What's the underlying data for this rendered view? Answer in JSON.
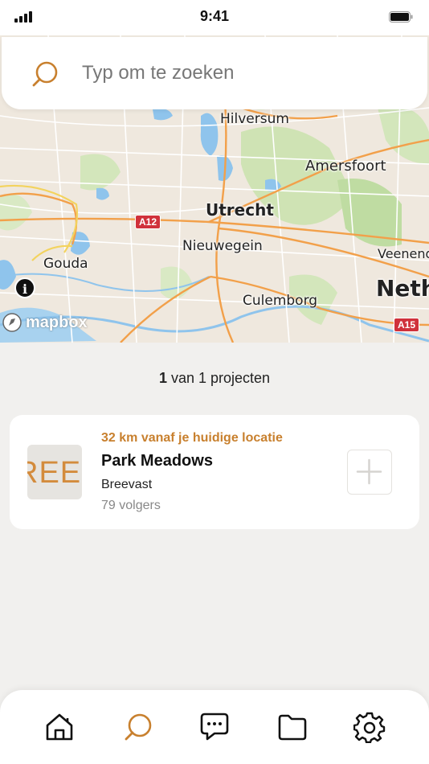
{
  "status_bar": {
    "time": "9:41"
  },
  "search": {
    "placeholder": "Typ om te zoeken"
  },
  "map": {
    "labels": {
      "hilversum": "Hilversum",
      "amersfoort": "Amersfoort",
      "utrecht": "Utrecht",
      "nieuwegein": "Nieuwegein",
      "gouda": "Gouda",
      "veenendaal": "Veenend",
      "culemborg": "Culemborg",
      "netherlands": "Neth"
    },
    "road_shields": {
      "a12": "A12",
      "a15": "A15"
    },
    "attribution": "mapbox",
    "info_glyph": "i"
  },
  "results": {
    "current": "1",
    "suffix": " van 1 projecten"
  },
  "project": {
    "distance": "32 km vanaf je huidige locatie",
    "name": "Park Meadows",
    "company": "Breevast",
    "followers": "79 volgers",
    "thumb_text": "REE"
  },
  "nav": {
    "active": "search",
    "items": [
      "home-icon",
      "search-icon",
      "messages-icon",
      "folder-icon",
      "gear-icon"
    ]
  },
  "colors": {
    "accent": "#c8802e",
    "background": "#f1f0ee",
    "shield": "#d0313b"
  }
}
